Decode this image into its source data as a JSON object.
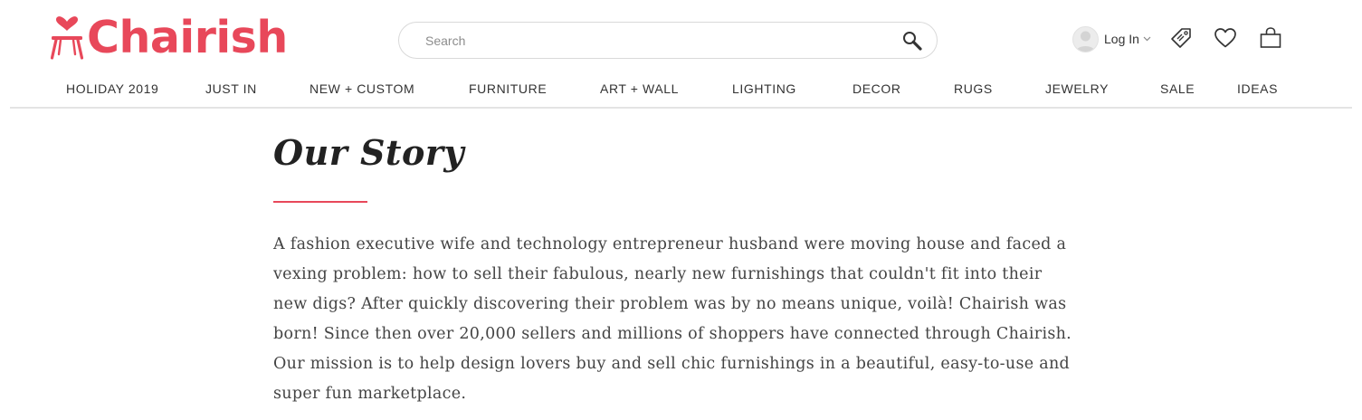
{
  "brand": {
    "name": "Chairish",
    "color": "#e8485a"
  },
  "search": {
    "placeholder": "Search",
    "value": "",
    "icon": "search-icon"
  },
  "account": {
    "login_label": "Log In",
    "avatar_icon": "user-avatar-icon",
    "caret_icon": "chevron-down-icon"
  },
  "header_icons": [
    {
      "name": "price-tag-icon"
    },
    {
      "name": "heart-icon"
    },
    {
      "name": "shopping-bag-icon"
    }
  ],
  "nav": {
    "items": [
      {
        "label": "HOLIDAY 2019"
      },
      {
        "label": "JUST IN"
      },
      {
        "label": "NEW + CUSTOM"
      },
      {
        "label": "FURNITURE"
      },
      {
        "label": "ART + WALL"
      },
      {
        "label": "LIGHTING"
      },
      {
        "label": "DECOR"
      },
      {
        "label": "RUGS"
      },
      {
        "label": "JEWELRY"
      },
      {
        "label": "SALE"
      },
      {
        "label": "IDEAS"
      }
    ]
  },
  "story": {
    "title": "Our Story",
    "body": "A fashion executive wife and technology entrepreneur husband were moving house and faced a vexing problem: how to sell their fabulous, nearly new furnishings that couldn't fit into their new digs? After quickly discovering their problem was by no means unique, voilà! Chairish was born! Since then over 20,000 sellers and millions of shoppers have connected through Chairish. Our mission is to help design lovers buy and sell chic furnishings in a beautiful, easy-to-use and super fun marketplace.",
    "accent_color": "#e8485a"
  }
}
